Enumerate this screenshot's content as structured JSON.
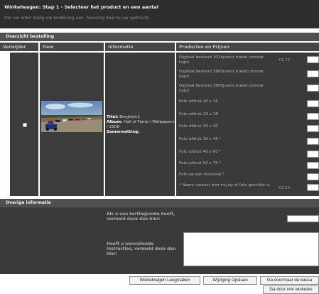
{
  "header": {
    "title": "Winkelwagen: Stap 1 - Selecteer het product en een aantal",
    "subtitle": "Pas uw order zodig uw bestelling aan, bevestig daarna uw opdracht."
  },
  "order_overview": {
    "label": "Overzicht bestelling"
  },
  "columns": [
    "Verwijder",
    "Item",
    "Informatie",
    "Producten en Prijzen"
  ],
  "item": {
    "title_label": "Titel:",
    "title_value": "Berghem1",
    "album_label": "Album:",
    "album_value": "Hall of Fame / Wallpapers / 2008",
    "summary_label": "Samenvatting:"
  },
  "products": [
    {
      "label": "Digitaal bestand 1024pixels breed (zonder logo)",
      "price": "€1,75"
    },
    {
      "label": "Digitaal bestand 1680pixels breed (zonder logo)",
      "price": ""
    },
    {
      "label": "Digitaal bestand 3800pixels breed (zonder logo)",
      "price": ""
    },
    {
      "label": "Foto afdruk 10 x 15",
      "price": ""
    },
    {
      "label": "Foto afdruk 13 x 18",
      "price": ""
    },
    {
      "label": "Foto afdruk 20 x 30",
      "price": ""
    },
    {
      "label": "Foto afdruk 30 x 45 *",
      "price": ""
    },
    {
      "label": "Foto afdruk 40 x 60 *",
      "price": ""
    },
    {
      "label": "Foto afdruk 50 x 75 *",
      "price": ""
    },
    {
      "label": "Foto op een muismat *",
      "price": ""
    },
    {
      "label": "* Neem contact met mij op of foto geschikt is.",
      "price": "€3,00"
    }
  ],
  "other_info": {
    "label": "Overige informatie",
    "coupon_label": "Als u een kortingscode heeft, vermeld deze dan hier:",
    "instructions_label": "Heeft u aanvullende instructies, vermeld deze dan hier:"
  },
  "buttons": {
    "empty_cart": "Winkelwagen Leegmaken",
    "save_changes": "Wijziging Opslaan",
    "checkout": "Ga doorrnaar de kassa",
    "continue_shopping": "Ga door met winkelen"
  }
}
